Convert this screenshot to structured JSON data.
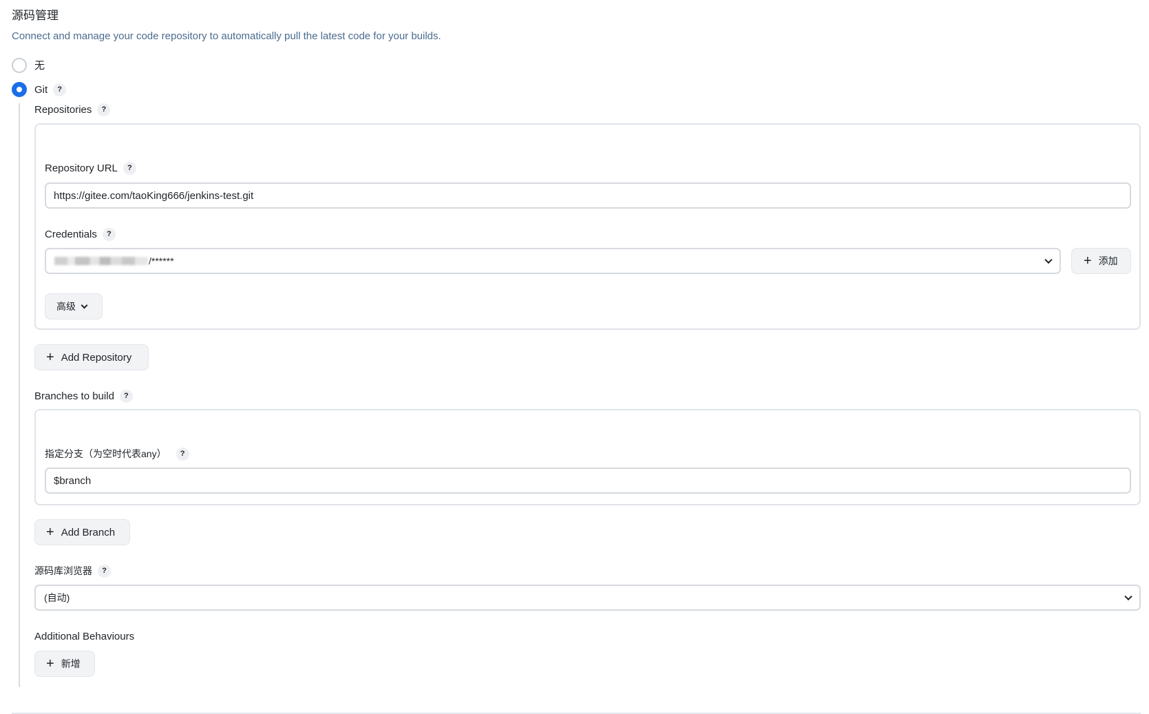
{
  "section": {
    "title": "源码管理",
    "description": "Connect and manage your code repository to automatically pull the latest code for your builds."
  },
  "scm_options": {
    "none_label": "无",
    "git_label": "Git",
    "help_glyph": "?"
  },
  "repositories": {
    "label": "Repositories",
    "url_label": "Repository URL",
    "url_value": "https://gitee.com/taoKing666/jenkins-test.git",
    "credentials_label": "Credentials",
    "credentials_value": "/******",
    "add_credentials_label": "添加",
    "advanced_label": "高级",
    "add_repository_label": "Add Repository"
  },
  "branches": {
    "label": "Branches to build",
    "specifier_label": "指定分支（为空时代表any）",
    "specifier_value": "$branch",
    "add_branch_label": "Add Branch"
  },
  "browser": {
    "label": "源码库浏览器",
    "selected": "(自动)"
  },
  "behaviours": {
    "label": "Additional Behaviours",
    "add_label": "新增"
  },
  "colors": {
    "accent": "#1a6ee8",
    "description_text": "#4b6b8f"
  }
}
